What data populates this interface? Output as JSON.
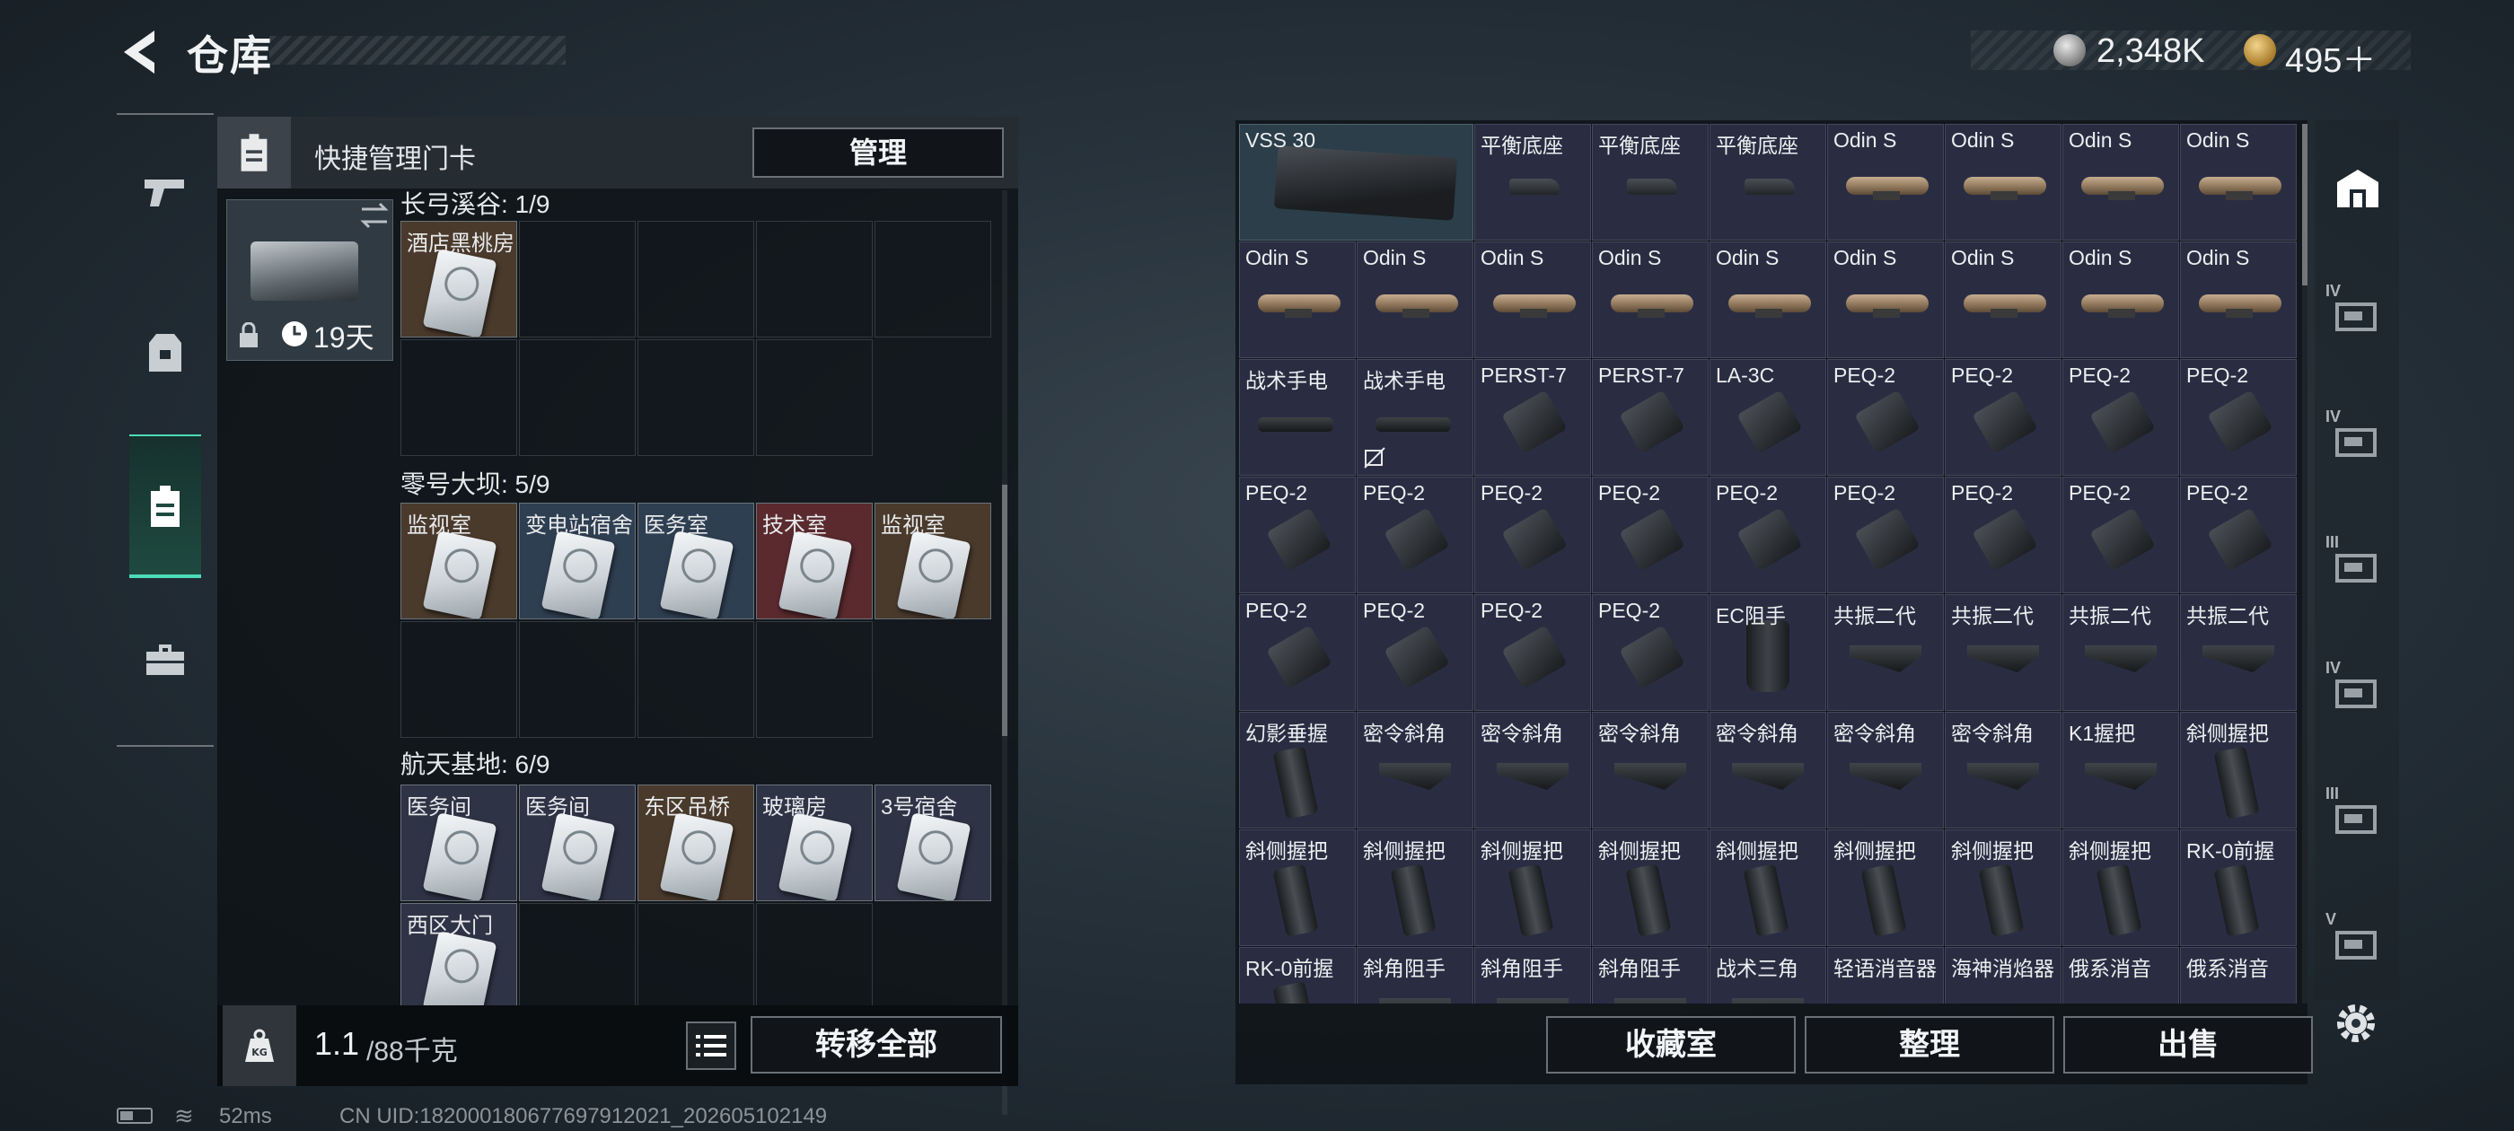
{
  "header": {
    "title": "仓库",
    "currency": [
      {
        "name": "silver-coin",
        "value": "2,348K"
      },
      {
        "name": "gold-coin",
        "value": "495＋"
      }
    ]
  },
  "left_nav": [
    {
      "name": "nav-weapons",
      "icon": "pistol-icon"
    },
    {
      "name": "nav-equipment",
      "icon": "vest-icon"
    },
    {
      "name": "nav-keycards",
      "icon": "keycard-icon",
      "active": true
    },
    {
      "name": "nav-toolbox",
      "icon": "toolbox-icon"
    }
  ],
  "keycard_panel": {
    "title": "快捷管理门卡",
    "manage_label": "管理",
    "selected_card_days": "19天",
    "areas": [
      {
        "label": "长弓溪谷: 1/9",
        "slots": [
          {
            "name": "酒店黑桃房",
            "tint": "#4a3a2c"
          }
        ],
        "total": 9
      },
      {
        "label": "零号大坝: 5/9",
        "slots": [
          {
            "name": "监视室",
            "tint": "#4a3a2c"
          },
          {
            "name": "变电站宿舍",
            "tint": "#2f3f52"
          },
          {
            "name": "医务室",
            "tint": "#2f3f52"
          },
          {
            "name": "技术室",
            "tint": "#5a2a2e"
          },
          {
            "name": "监视室",
            "tint": "#4a3a2c"
          }
        ],
        "total": 9
      },
      {
        "label": "航天基地: 6/9",
        "slots": [
          {
            "name": "医务间",
            "tint": "#2f3346"
          },
          {
            "name": "医务间",
            "tint": "#2f3346"
          },
          {
            "name": "东区吊桥",
            "tint": "#4a3a2c"
          },
          {
            "name": "玻璃房",
            "tint": "#2f3346"
          },
          {
            "name": "3号宿舍",
            "tint": "#2f3346"
          },
          {
            "name": "西区大门",
            "tint": "#2f3346"
          }
        ],
        "total": 9
      }
    ],
    "weight_current": "1.1",
    "weight_max": "/88千克",
    "transfer_all_label": "转移全部"
  },
  "status_bar": {
    "ping": "52ms",
    "uid": "CN UID:182000180677697912021_202605102149"
  },
  "stash": {
    "items": [
      {
        "name": "VSS 30",
        "art": "mag",
        "big": true
      },
      {
        "name": "平衡底座",
        "art": "mount"
      },
      {
        "name": "平衡底座",
        "art": "mount"
      },
      {
        "name": "平衡底座",
        "art": "mount"
      },
      {
        "name": "Odin S",
        "art": "scope"
      },
      {
        "name": "Odin S",
        "art": "scope"
      },
      {
        "name": "Odin S",
        "art": "scope"
      },
      {
        "name": "Odin S",
        "art": "scope"
      },
      {
        "name": "Odin S",
        "art": "scope"
      },
      {
        "name": "Odin S",
        "art": "scope"
      },
      {
        "name": "Odin S",
        "art": "scope"
      },
      {
        "name": "Odin S",
        "art": "scope"
      },
      {
        "name": "Odin S",
        "art": "scope"
      },
      {
        "name": "Odin S",
        "art": "scope"
      },
      {
        "name": "Odin S",
        "art": "scope"
      },
      {
        "name": "Odin S",
        "art": "scope"
      },
      {
        "name": "Odin S",
        "art": "scope"
      },
      {
        "name": "战术手电",
        "art": "flash"
      },
      {
        "name": "战术手电",
        "art": "flash",
        "flag": true
      },
      {
        "name": "PERST-7",
        "art": "laser"
      },
      {
        "name": "PERST-7",
        "art": "laser"
      },
      {
        "name": "LA-3C",
        "art": "laser"
      },
      {
        "name": "PEQ-2",
        "art": "laser"
      },
      {
        "name": "PEQ-2",
        "art": "laser"
      },
      {
        "name": "PEQ-2",
        "art": "laser"
      },
      {
        "name": "PEQ-2",
        "art": "laser"
      },
      {
        "name": "PEQ-2",
        "art": "laser"
      },
      {
        "name": "PEQ-2",
        "art": "laser"
      },
      {
        "name": "PEQ-2",
        "art": "laser"
      },
      {
        "name": "PEQ-2",
        "art": "laser"
      },
      {
        "name": "PEQ-2",
        "art": "laser"
      },
      {
        "name": "PEQ-2",
        "art": "laser"
      },
      {
        "name": "PEQ-2",
        "art": "laser"
      },
      {
        "name": "PEQ-2",
        "art": "laser"
      },
      {
        "name": "PEQ-2",
        "art": "laser"
      },
      {
        "name": "PEQ-2",
        "art": "laser"
      },
      {
        "name": "PEQ-2",
        "art": "laser"
      },
      {
        "name": "PEQ-2",
        "art": "laser"
      },
      {
        "name": "PEQ-2",
        "art": "laser"
      },
      {
        "name": "EC阻手",
        "art": "ec"
      },
      {
        "name": "共振二代",
        "art": "grip-angle"
      },
      {
        "name": "共振二代",
        "art": "grip-angle"
      },
      {
        "name": "共振二代",
        "art": "grip-angle"
      },
      {
        "name": "共振二代",
        "art": "grip-angle"
      },
      {
        "name": "幻影垂握",
        "art": "grip-vert"
      },
      {
        "name": "密令斜角",
        "art": "grip-angle"
      },
      {
        "name": "密令斜角",
        "art": "grip-angle"
      },
      {
        "name": "密令斜角",
        "art": "grip-angle"
      },
      {
        "name": "密令斜角",
        "art": "grip-angle"
      },
      {
        "name": "密令斜角",
        "art": "grip-angle"
      },
      {
        "name": "密令斜角",
        "art": "grip-angle"
      },
      {
        "name": "K1握把",
        "art": "grip-angle"
      },
      {
        "name": "斜侧握把",
        "art": "grip-vert"
      },
      {
        "name": "斜侧握把",
        "art": "grip-vert"
      },
      {
        "name": "斜侧握把",
        "art": "grip-vert"
      },
      {
        "name": "斜侧握把",
        "art": "grip-vert"
      },
      {
        "name": "斜侧握把",
        "art": "grip-vert"
      },
      {
        "name": "斜侧握把",
        "art": "grip-vert"
      },
      {
        "name": "斜侧握把",
        "art": "grip-vert"
      },
      {
        "name": "斜侧握把",
        "art": "grip-vert"
      },
      {
        "name": "斜侧握把",
        "art": "grip-vert"
      },
      {
        "name": "RK-0前握",
        "art": "grip-vert"
      },
      {
        "name": "RK-0前握",
        "art": "grip-vert"
      },
      {
        "name": "斜角阻手",
        "art": "grip-angle"
      },
      {
        "name": "斜角阻手",
        "art": "grip-angle"
      },
      {
        "name": "斜角阻手",
        "art": "grip-angle"
      },
      {
        "name": "战术三角",
        "art": "grip-angle"
      },
      {
        "name": "轻语消音器",
        "art": "supp"
      },
      {
        "name": "海神消焰器",
        "art": "supp"
      },
      {
        "name": "俄系消音",
        "art": "supp"
      },
      {
        "name": "俄系消音",
        "art": "supp"
      }
    ],
    "buttons": {
      "collection": "收藏室",
      "sort": "整理",
      "sell": "出售"
    }
  },
  "right_nav": [
    {
      "name": "stash-home",
      "icon": "warehouse-icon",
      "tier": ""
    },
    {
      "name": "stash-4-add",
      "icon": "case-add-icon",
      "tier": "IV"
    },
    {
      "name": "stash-4-folder",
      "icon": "folder-icon",
      "tier": "IV"
    },
    {
      "name": "stash-3-gun",
      "icon": "gun-case-icon",
      "tier": "III"
    },
    {
      "name": "stash-4-box",
      "icon": "box-icon",
      "tier": "IV"
    },
    {
      "name": "stash-3-rifle",
      "icon": "rifle-case-icon",
      "tier": "III"
    },
    {
      "name": "stash-5-crate",
      "icon": "crate-icon",
      "tier": "V"
    }
  ]
}
